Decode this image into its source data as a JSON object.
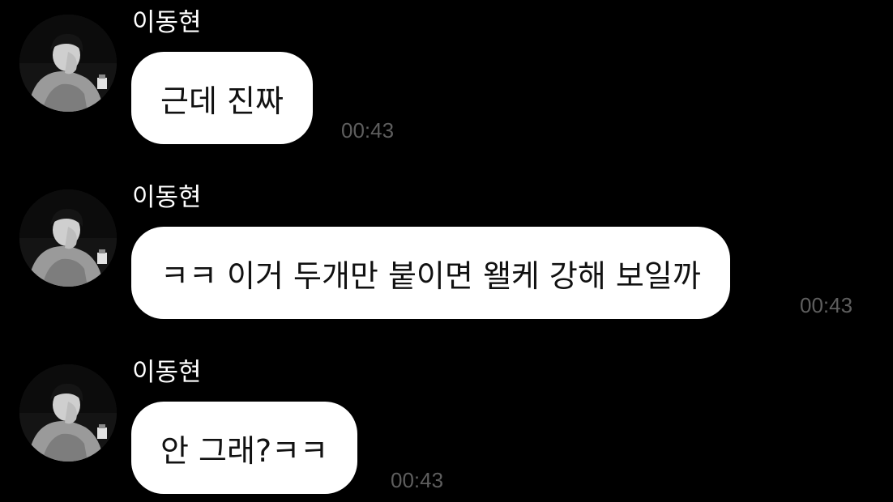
{
  "messages": [
    {
      "sender": "이동현",
      "text": "근데 진짜",
      "time": "00:43",
      "avatar_icon": "profile-photo"
    },
    {
      "sender": "이동현",
      "text": "ㅋㅋ 이거 두개만 붙이면 왤케 강해 보일까",
      "time": "00:43",
      "avatar_icon": "profile-photo"
    },
    {
      "sender": "이동현",
      "text": "안 그래?ㅋㅋ",
      "time": "00:43",
      "avatar_icon": "profile-photo"
    }
  ],
  "colors": {
    "background": "#000000",
    "bubble": "#ffffff",
    "bubble_text": "#111111",
    "sender_text": "#ffffff",
    "timestamp": "#5e5e5e"
  }
}
